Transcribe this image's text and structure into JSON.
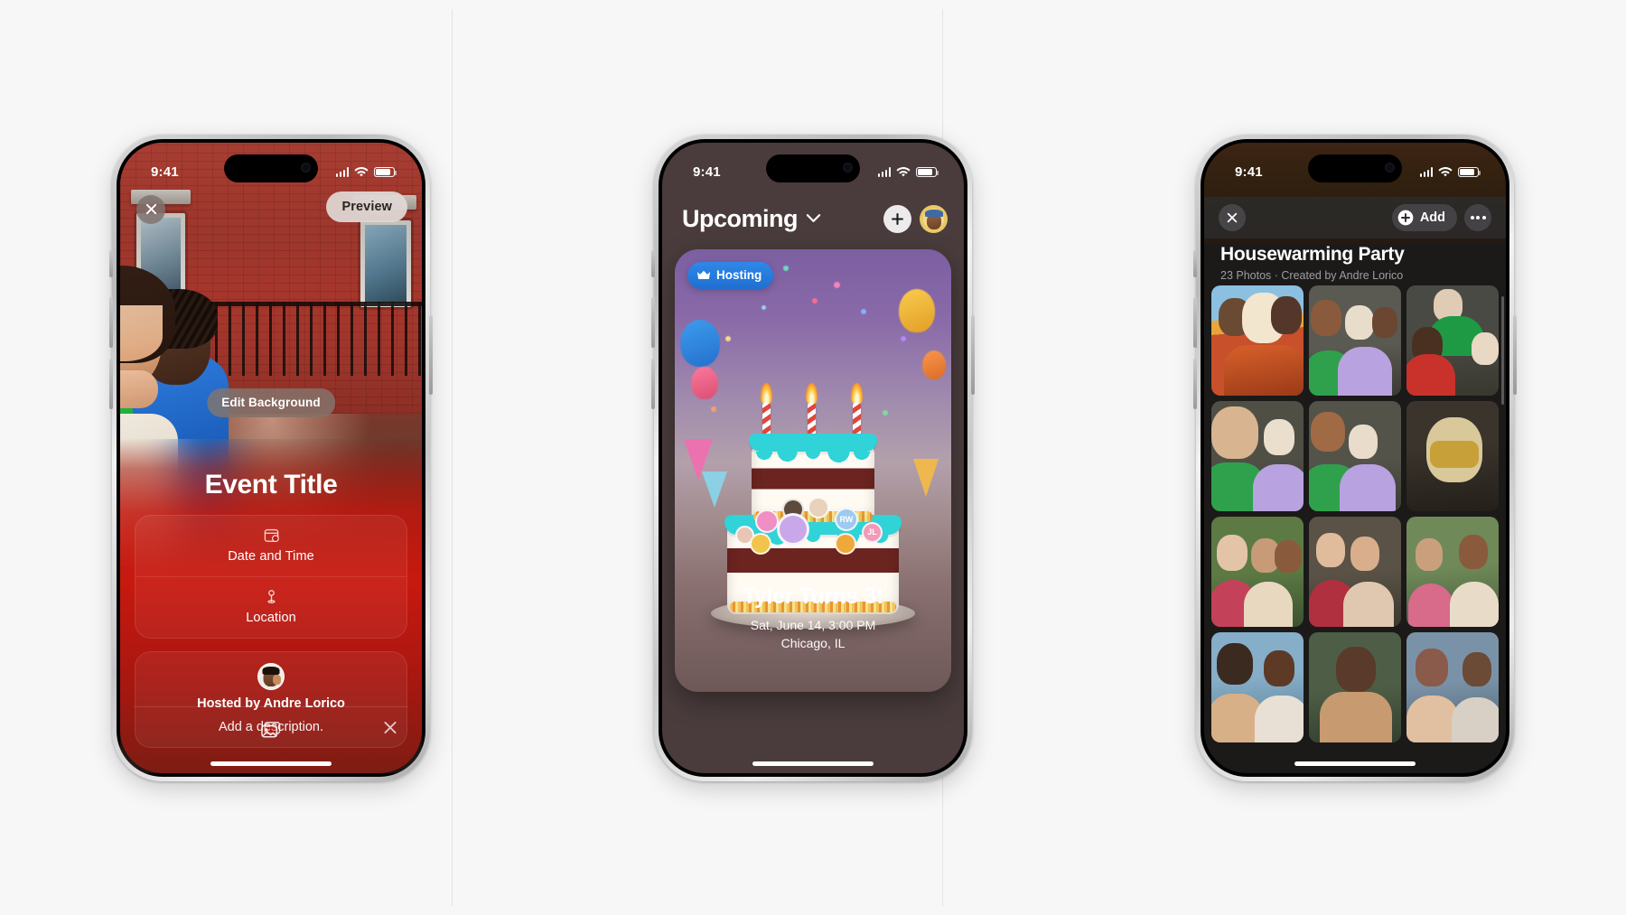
{
  "meta": {
    "background_color": "#f7f7f7",
    "panel_count": 3
  },
  "status_bar": {
    "time": "9:41",
    "cellular_icon": "signal-bars-icon",
    "wifi_icon": "wifi-icon",
    "battery_icon": "battery-icon"
  },
  "phone1": {
    "name": "event-editor-screen",
    "close_icon": "close-icon",
    "preview_button": "Preview",
    "edit_background_button": "Edit Background",
    "event_title": "Event Title",
    "fields": [
      {
        "icon": "calendar-icon",
        "label": "Date and Time"
      },
      {
        "icon": "location-pin-icon",
        "label": "Location"
      }
    ],
    "host_avatar": "host-avatar",
    "host_label": "Hosted by Andre Lorico",
    "description_placeholder": "Add a description.",
    "toolbar": {
      "photos_icon": "photos-icon",
      "close_icon": "close-icon"
    },
    "accent_color": "#c8190f"
  },
  "phone2": {
    "name": "upcoming-events-screen",
    "header": {
      "title": "Upcoming",
      "chevron_icon": "chevron-down-icon",
      "add_icon": "plus-icon",
      "profile_avatar": "profile-avatar"
    },
    "card": {
      "badge": {
        "icon": "crown-icon",
        "label": "Hosting",
        "color": "#2478dd"
      },
      "event_title": "Tyler Turns 3!",
      "event_datetime": "Sat, June 14, 3:00 PM",
      "event_location": "Chicago, IL",
      "attendees": [
        {
          "type": "photo",
          "color": "#e7b7d4"
        },
        {
          "type": "photo",
          "color": "#f0d3b8"
        },
        {
          "type": "photo",
          "color": "#d8b98f"
        },
        {
          "type": "photo",
          "color": "#e8a3c4"
        },
        {
          "type": "initials",
          "label": "RW",
          "color": "#9ec9f0"
        },
        {
          "type": "initials",
          "label": "JL",
          "color": "#f29ab8"
        },
        {
          "type": "photo",
          "color": "#f2c44b"
        },
        {
          "type": "photo",
          "color": "#f0b04a"
        },
        {
          "type": "photo",
          "color": "#c9a8ea"
        }
      ]
    }
  },
  "phone3": {
    "name": "shared-album-screen",
    "nav": {
      "close_icon": "close-icon",
      "add_icon": "plus-circle-icon",
      "add_label": "Add",
      "more_icon": "more-horizontal-icon"
    },
    "album_title": "Housewarming Party",
    "album_subtitle": "23 Photos · Created by Andre Lorico",
    "photo_count": 23,
    "photos": [
      {
        "id": "photo-1",
        "sky": "#7fb2d8",
        "subject": "#d8602a",
        "accent": "#f2d08a"
      },
      {
        "id": "photo-2",
        "sky": "#4a4a46",
        "subject": "#b9a2e0",
        "accent": "#2fa14c"
      },
      {
        "id": "photo-3",
        "sky": "#3c4440",
        "subject": "#c8322a",
        "accent": "#1f9a44"
      },
      {
        "id": "photo-4",
        "sky": "#3f4a3e",
        "subject": "#b9a2e0",
        "accent": "#2fa14c"
      },
      {
        "id": "photo-5",
        "sky": "#444440",
        "subject": "#b9a2e0",
        "accent": "#2fa14c"
      },
      {
        "id": "photo-6",
        "sky": "#2f2a24",
        "subject": "#d8c89a",
        "accent": "#c8a03a"
      },
      {
        "id": "photo-7",
        "sky": "#3e5233",
        "subject": "#c4415a",
        "accent": "#e8d8c0"
      },
      {
        "id": "photo-8",
        "sky": "#4a4236",
        "subject": "#b03040",
        "accent": "#e0c8b0"
      },
      {
        "id": "photo-9",
        "sky": "#5a6a4a",
        "subject": "#d86a8a",
        "accent": "#e8dcc8"
      },
      {
        "id": "photo-10",
        "sky": "#6a8aa8",
        "subject": "#3a2a20",
        "accent": "#d8b088"
      },
      {
        "id": "photo-11",
        "sky": "#3a4a3a",
        "subject": "#5a3a2a",
        "accent": "#c89a70"
      },
      {
        "id": "photo-12",
        "sky": "#5a6a7a",
        "subject": "#8a5a4a",
        "accent": "#e0c0a0"
      }
    ]
  }
}
